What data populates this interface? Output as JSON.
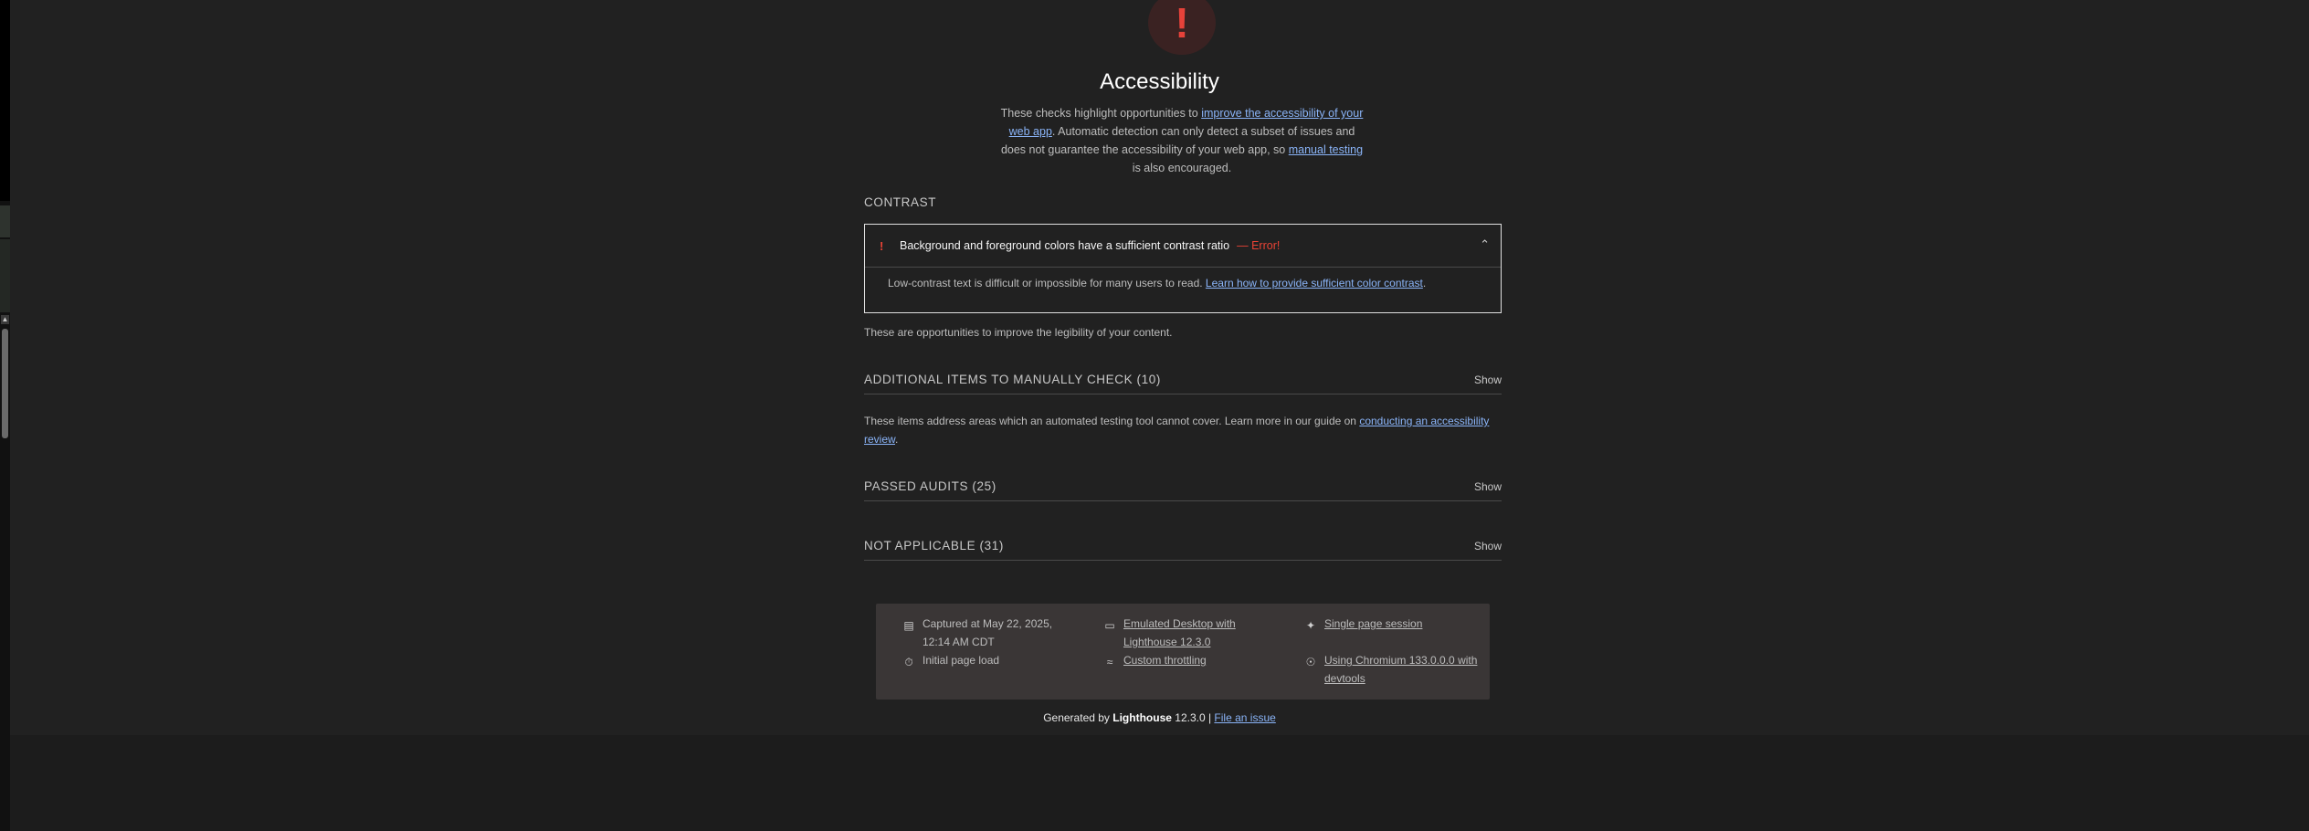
{
  "category": {
    "gauge_symbol": "!",
    "title": "Accessibility",
    "desc_part1": "These checks highlight opportunities to ",
    "desc_link1": "improve the accessibility of your web app",
    "desc_part2": ". Automatic detection can only detect a subset of issues and does not guarantee the accessibility of your web app, so ",
    "desc_link2": "manual testing",
    "desc_part3": " is also encouraged."
  },
  "contrast_group": {
    "title": "CONTRAST",
    "audit": {
      "icon": "!",
      "title": "Background and foreground colors have a sufficient contrast ratio",
      "error_tag": "— Error!",
      "body_text": "Low-contrast text is difficult or impossible for many users to read. ",
      "body_link": "Learn how to provide sufficient color contrast",
      "body_end": "."
    },
    "footer_desc": "These are opportunities to improve the legibility of your content."
  },
  "clumps": {
    "manual": {
      "title": "ADDITIONAL ITEMS TO MANUALLY CHECK (10)",
      "show": "Show"
    },
    "manual_desc_text": "These items address areas which an automated testing tool cannot cover. Learn more in our guide on ",
    "manual_desc_link": "conducting an accessibility review",
    "manual_desc_end": ".",
    "passed": {
      "title": "PASSED AUDITS (25)",
      "show": "Show"
    },
    "not_applicable": {
      "title": "NOT APPLICABLE (31)",
      "show": "Show"
    }
  },
  "meta": {
    "captured": "Captured at May 22, 2025, 12:14 AM CDT",
    "initial_load": "Initial page load",
    "emulated": "Emulated Desktop with Lighthouse 12.3.0",
    "throttling": "Custom throttling",
    "session": "Single page session",
    "chromium": "Using Chromium 133.0.0.0 with devtools"
  },
  "footer": {
    "generated_by": "Generated by ",
    "brand": "Lighthouse",
    "version": " 12.3.0 | ",
    "issue_link": "File an issue"
  },
  "colors": {
    "error": "#ea4335",
    "link": "#8ab4f8",
    "background": "#212121"
  }
}
